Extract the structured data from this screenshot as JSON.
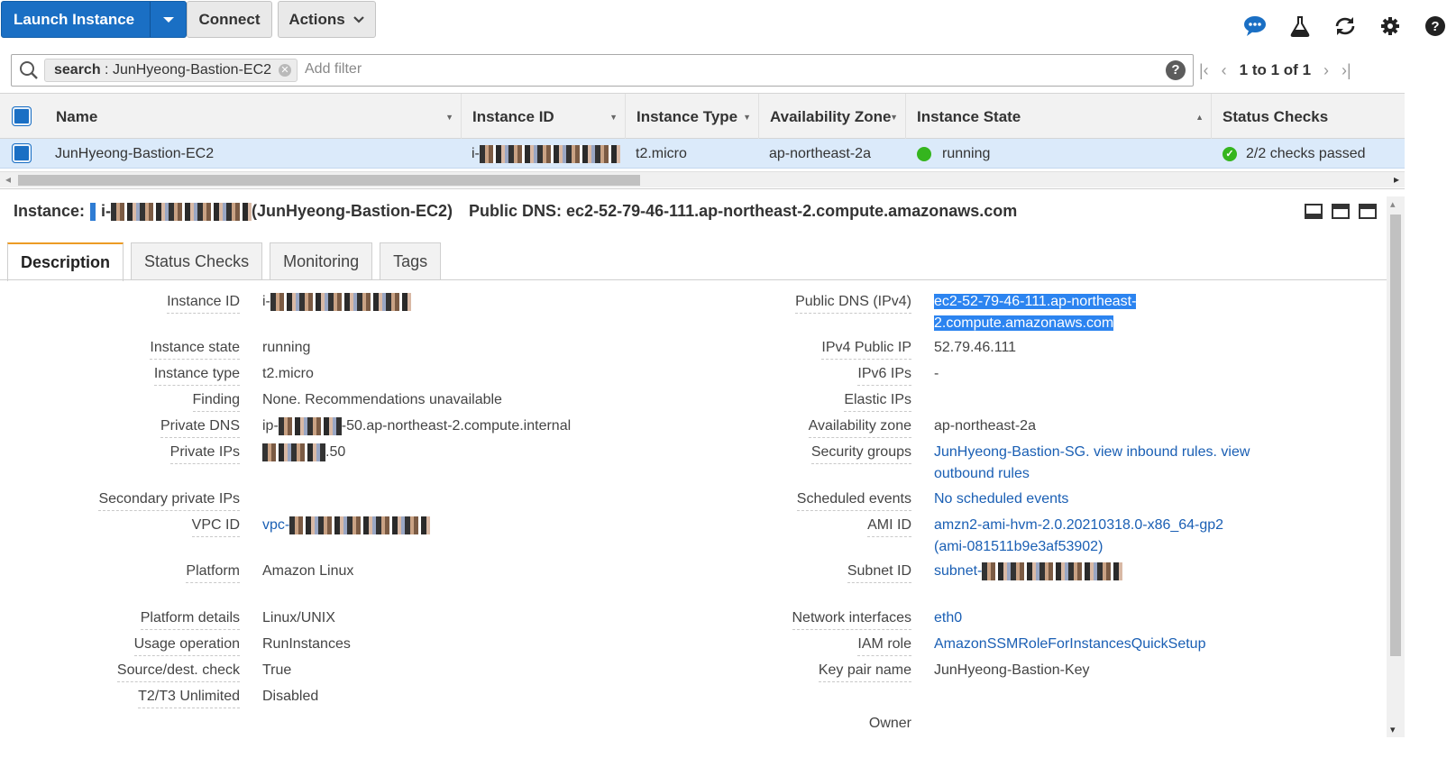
{
  "toolbar": {
    "launch_label": "Launch Instance",
    "connect_label": "Connect",
    "actions_label": "Actions"
  },
  "search": {
    "chip_key": "search",
    "chip_value": "JunHyeong-Bastion-EC2",
    "placeholder": "Add filter"
  },
  "pager": {
    "count": "1 to 1 of 1"
  },
  "table": {
    "columns": [
      "Name",
      "Instance ID",
      "Instance Type",
      "Availability Zone",
      "Instance State",
      "Status Checks"
    ],
    "rows": [
      {
        "name": "JunHyeong-Bastion-EC2",
        "instance_id_prefix": "i-",
        "instance_type": "t2.micro",
        "availability_zone": "ap-northeast-2a",
        "state": "running",
        "status_checks": "2/2 checks passed"
      }
    ]
  },
  "instance_header": {
    "label": "Instance:",
    "id_prefix": "i-",
    "name_suffix": "(JunHyeong-Bastion-EC2)",
    "public_dns_label": "Public DNS:",
    "public_dns_value": "ec2-52-79-46-111.ap-northeast-2.compute.amazonaws.com"
  },
  "tabs": [
    "Description",
    "Status Checks",
    "Monitoring",
    "Tags"
  ],
  "details_left": {
    "instance_id": {
      "label": "Instance ID",
      "value_prefix": "i-"
    },
    "instance_state": {
      "label": "Instance state",
      "value": "running"
    },
    "instance_type": {
      "label": "Instance type",
      "value": "t2.micro"
    },
    "finding": {
      "label": "Finding",
      "value": "None. Recommendations unavailable"
    },
    "private_dns": {
      "label": "Private DNS",
      "value_prefix": "ip-",
      "value_suffix": "-50.ap-northeast-2.compute.internal"
    },
    "private_ips": {
      "label": "Private IPs",
      "value_suffix": ".50"
    },
    "secondary_private_ips": {
      "label": "Secondary private IPs"
    },
    "vpc_id": {
      "label": "VPC ID",
      "value_prefix": "vpc-"
    },
    "platform": {
      "label": "Platform",
      "value": "Amazon Linux"
    },
    "platform_details": {
      "label": "Platform details",
      "value": "Linux/UNIX"
    },
    "usage_operation": {
      "label": "Usage operation",
      "value": "RunInstances"
    },
    "source_dest_check": {
      "label": "Source/dest. check",
      "value": "True"
    },
    "t2_t3_unlimited": {
      "label": "T2/T3 Unlimited",
      "value": "Disabled"
    }
  },
  "details_right": {
    "public_dns": {
      "label": "Public DNS (IPv4)",
      "value_line1": "ec2-52-79-46-111.ap-northeast-",
      "value_line2": "2.compute.amazonaws.com"
    },
    "ipv4_public_ip": {
      "label": "IPv4 Public IP",
      "value": "52.79.46.111"
    },
    "ipv6_ips": {
      "label": "IPv6 IPs",
      "value": "-"
    },
    "elastic_ips": {
      "label": "Elastic IPs"
    },
    "availability_zone": {
      "label": "Availability zone",
      "value": "ap-northeast-2a"
    },
    "security_groups": {
      "label": "Security groups",
      "sg_link": "JunHyeong-Bastion-SG",
      "sep1": ". ",
      "inbound_link": "view inbound rules",
      "sep2": ". ",
      "outbound_link": "view outbound rules"
    },
    "scheduled_events": {
      "label": "Scheduled events",
      "value": "No scheduled events"
    },
    "ami_id": {
      "label": "AMI ID",
      "value": "amzn2-ami-hvm-2.0.20210318.0-x86_64-gp2 (ami-081511b9e3af53902)"
    },
    "subnet_id": {
      "label": "Subnet ID",
      "value_prefix": "subnet-"
    },
    "network_interfaces": {
      "label": "Network interfaces",
      "value": "eth0"
    },
    "iam_role": {
      "label": "IAM role",
      "value": "AmazonSSMRoleForInstancesQuickSetup"
    },
    "key_pair_name": {
      "label": "Key pair name",
      "value": "JunHyeong-Bastion-Key"
    },
    "owner": {
      "label": "Owner"
    }
  },
  "colors": {
    "primary_button": "#1a6fc4",
    "selected_row": "#dbeafa",
    "running_green": "#35b51e",
    "link_blue": "#1a5fb4",
    "active_tab_accent": "#ec9b25",
    "text_selection": "#2c84f0"
  }
}
